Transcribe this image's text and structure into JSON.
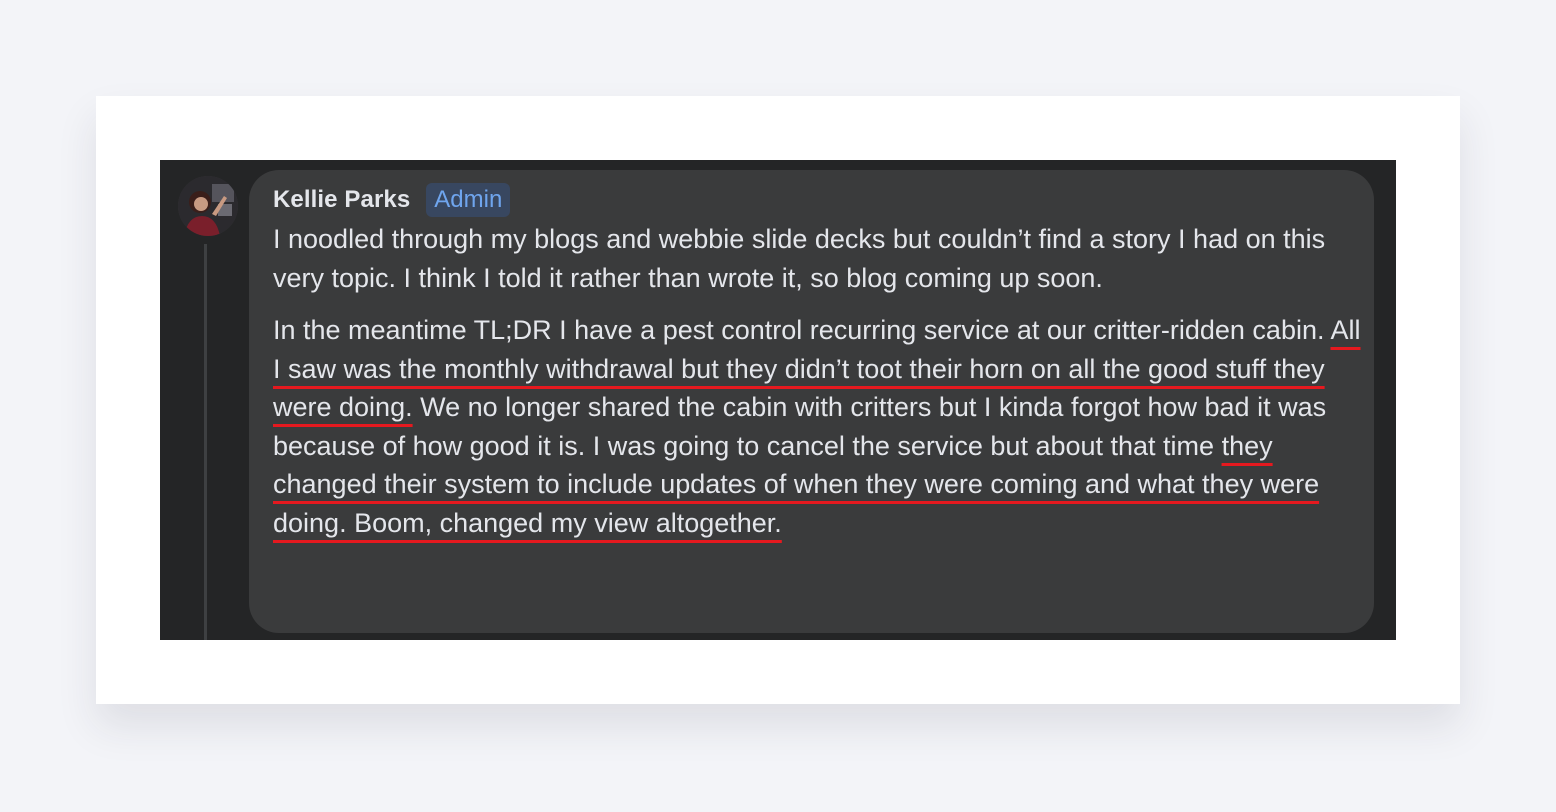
{
  "comment": {
    "author": "Kellie Parks",
    "badge": "Admin",
    "paragraph1": "I noodled through my blogs and webbie slide decks but couldn’t find a story I had on this very topic. I think I told it rather than wrote it, so blog coming up soon.",
    "paragraph2": {
      "part1": "In the meantime TL;DR I have a pest control recurring service at our critter-ridden cabin. ",
      "highlight1": "All I saw was the monthly withdrawal but they didn’t toot their horn on all the good stuff they were doing.",
      "part2": " We no longer shared the cabin with critters but I kinda forgot how bad it was because of how good it is. I was going to cancel the service but about that time ",
      "highlight2": "they changed their system to include updates of when they were coming and what they were doing. Boom, changed my view altogether."
    }
  },
  "colors": {
    "page_background": "#f3f4f8",
    "card_background": "#ffffff",
    "screenshot_background": "#242526",
    "bubble_background": "#3a3b3c",
    "text": "#e4e6eb",
    "badge_text": "#6fa5ee",
    "badge_background": "#384760",
    "highlight_underline": "#e5191f"
  },
  "icons": {
    "avatar": "profile-photo"
  }
}
